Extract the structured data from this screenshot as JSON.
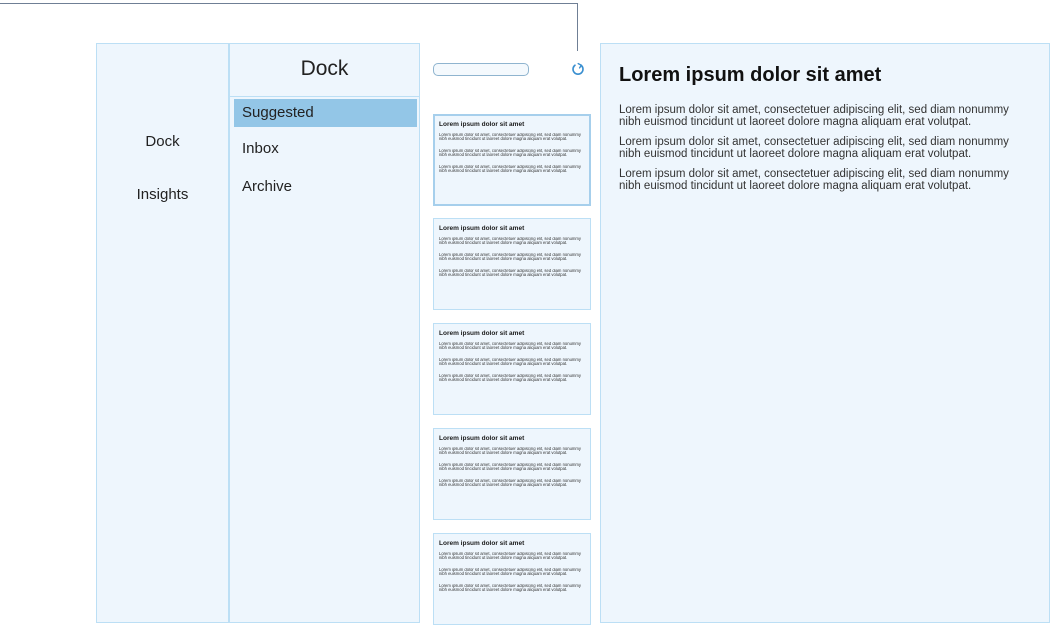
{
  "nav": {
    "items": [
      {
        "label": "Dock"
      },
      {
        "label": "Insights"
      }
    ]
  },
  "folders": {
    "header": "Dock",
    "items": [
      {
        "label": "Suggested",
        "selected": true
      },
      {
        "label": "Inbox",
        "selected": false
      },
      {
        "label": "Archive",
        "selected": false
      }
    ]
  },
  "toolbar": {
    "search_value": "",
    "refresh_icon": "refresh-icon"
  },
  "messages": [
    {
      "title": "Lorem ipsum dolor sit amet",
      "paragraphs": [
        "Lorem ipsum dolor sit amet, consectetuer adipiscing elit, sed diam nonummy nibh euismod tincidunt ut laoreet dolore magna aliquam erat volutpat.",
        "Lorem ipsum dolor sit amet, consectetuer adipiscing elit, sed diam nonummy nibh euismod tincidunt ut laoreet dolore magna aliquam erat volutpat.",
        "Lorem ipsum dolor sit amet, consectetuer adipiscing elit, sed diam nonummy nibh euismod tincidunt ut laoreet dolore magna aliquam erat volutpat."
      ]
    },
    {
      "title": "Lorem ipsum dolor sit amet",
      "paragraphs": [
        "Lorem ipsum dolor sit amet, consectetuer adipiscing elit, sed diam nonummy nibh euismod tincidunt ut laoreet dolore magna aliquam erat volutpat.",
        "Lorem ipsum dolor sit amet, consectetuer adipiscing elit, sed diam nonummy nibh euismod tincidunt ut laoreet dolore magna aliquam erat volutpat.",
        "Lorem ipsum dolor sit amet, consectetuer adipiscing elit, sed diam nonummy nibh euismod tincidunt ut laoreet dolore magna aliquam erat volutpat."
      ]
    },
    {
      "title": "Lorem ipsum dolor sit amet",
      "paragraphs": [
        "Lorem ipsum dolor sit amet, consectetuer adipiscing elit, sed diam nonummy nibh euismod tincidunt ut laoreet dolore magna aliquam erat volutpat.",
        "Lorem ipsum dolor sit amet, consectetuer adipiscing elit, sed diam nonummy nibh euismod tincidunt ut laoreet dolore magna aliquam erat volutpat.",
        "Lorem ipsum dolor sit amet, consectetuer adipiscing elit, sed diam nonummy nibh euismod tincidunt ut laoreet dolore magna aliquam erat volutpat."
      ]
    },
    {
      "title": "Lorem ipsum dolor sit amet",
      "paragraphs": [
        "Lorem ipsum dolor sit amet, consectetuer adipiscing elit, sed diam nonummy nibh euismod tincidunt ut laoreet dolore magna aliquam erat volutpat.",
        "Lorem ipsum dolor sit amet, consectetuer adipiscing elit, sed diam nonummy nibh euismod tincidunt ut laoreet dolore magna aliquam erat volutpat.",
        "Lorem ipsum dolor sit amet, consectetuer adipiscing elit, sed diam nonummy nibh euismod tincidunt ut laoreet dolore magna aliquam erat volutpat."
      ]
    },
    {
      "title": "Lorem ipsum dolor sit amet",
      "paragraphs": [
        "Lorem ipsum dolor sit amet, consectetuer adipiscing elit, sed diam nonummy nibh euismod tincidunt ut laoreet dolore magna aliquam erat volutpat.",
        "Lorem ipsum dolor sit amet, consectetuer adipiscing elit, sed diam nonummy nibh euismod tincidunt ut laoreet dolore magna aliquam erat volutpat.",
        "Lorem ipsum dolor sit amet, consectetuer adipiscing elit, sed diam nonummy nibh euismod tincidunt ut laoreet dolore magna aliquam erat volutpat."
      ]
    }
  ],
  "reading": {
    "title": "Lorem ipsum dolor sit amet",
    "paragraphs": [
      "Lorem ipsum dolor sit amet, consectetuer adipiscing elit, sed diam nonummy nibh euismod tincidunt ut laoreet dolore magna aliquam erat volutpat.",
      "Lorem ipsum dolor sit amet, consectetuer adipiscing elit, sed diam nonummy nibh euismod tincidunt ut laoreet dolore magna aliquam erat volutpat.",
      "Lorem ipsum dolor sit amet, consectetuer adipiscing elit, sed diam nonummy nibh euismod tincidunt ut laoreet dolore magna aliquam erat volutpat."
    ]
  },
  "colors": {
    "panel_bg": "#eef6fd",
    "panel_border": "#bcdff5",
    "selected_bg": "#93c6e7",
    "accent": "#3a8fd0"
  }
}
